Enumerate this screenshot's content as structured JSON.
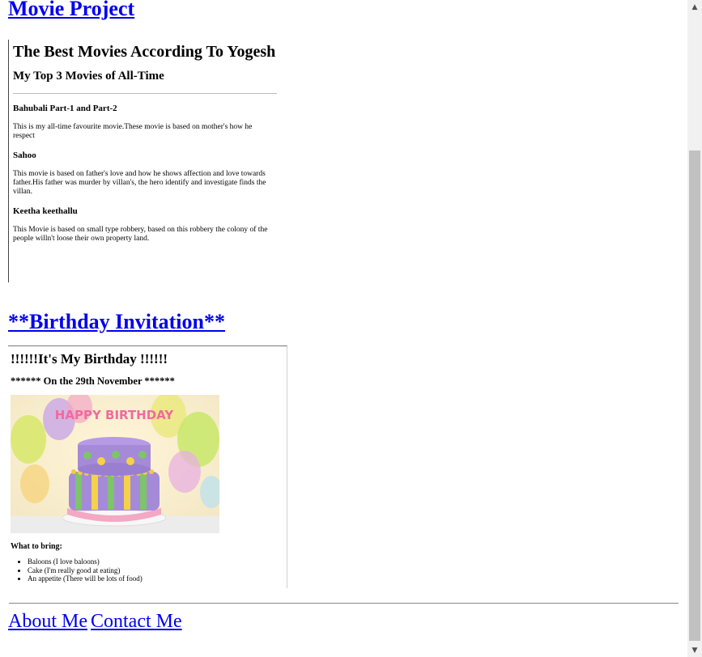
{
  "movie_project": {
    "title": "Movie Project",
    "heading": "The Best Movies According To Yogesh",
    "subheading": "My Top 3 Movies of All-Time",
    "movies": [
      {
        "name": "Bahubali Part-1 and Part-2",
        "description": "This is my all-time favourite movie.These movie is based on mother's how he respect"
      },
      {
        "name": "Sahoo",
        "description": "This movie is based on father's love and how he shows affection and love towards father.His father was murder by villan's, the hero identify and investigate finds the villan."
      },
      {
        "name": "Keetha keethallu",
        "description": "This Movie is based on small type robbery, based on this robbery the colony of the people willn't loose their own property land."
      }
    ]
  },
  "birthday": {
    "title": "**Birthday Invitation**",
    "heading": "!!!!!!It's My Birthday !!!!!!",
    "date_line": "****** On the 29th November ******",
    "cake_text": "HAPPY BIRTHDAY",
    "what_to_bring": "What to bring:",
    "items": [
      "Baloons (I love baloons)",
      "Cake (I'm really good at eating)",
      "An appetite (There will be lots of food)"
    ]
  },
  "footer": {
    "about": "About Me",
    "contact": "Contact Me"
  },
  "scrollbar": {
    "scroll_fraction": 0.23
  }
}
